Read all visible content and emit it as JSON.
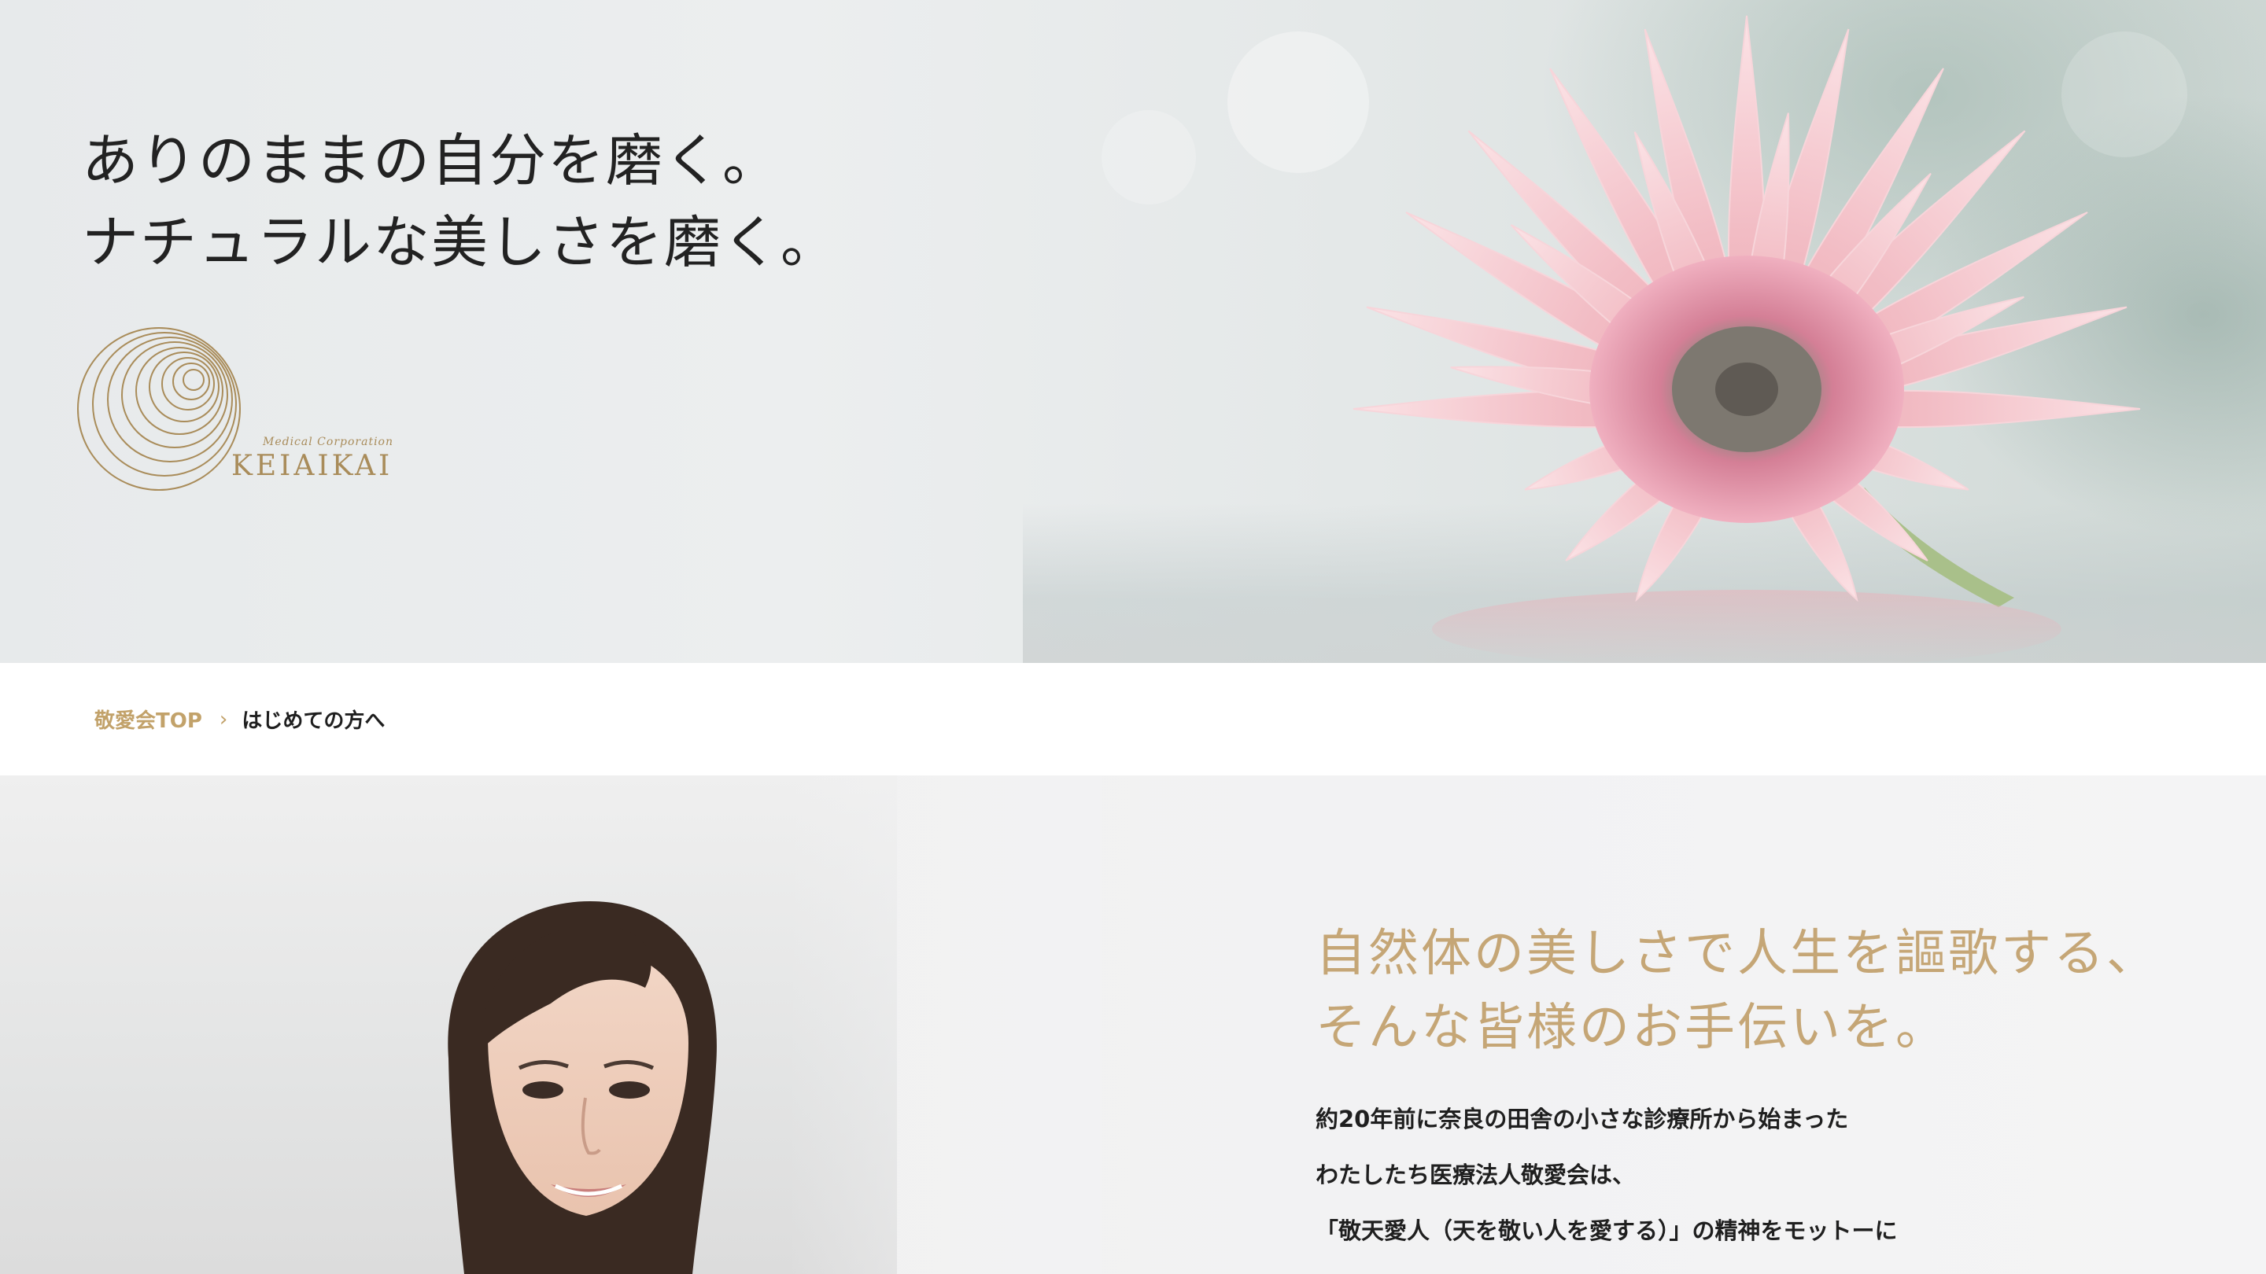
{
  "hero": {
    "title_line1": "ありのままの自分を磨く。",
    "title_line2": "ナチュラルな美しさを磨く。",
    "logo": {
      "subtitle": "Medical Corporation",
      "name": "KEIAIKAI",
      "color": "#a98c5a"
    }
  },
  "breadcrumb": {
    "home_label": "敬愛会TOP",
    "separator": "›",
    "current_label": "はじめての方へ"
  },
  "intro": {
    "heading_line1": "自然体の美しさで人生を謳歌する、",
    "heading_line2": "そんな皆様のお手伝いを。",
    "body_lines": [
      "約20年前に奈良の田舎の小さな診療所から始まった",
      "わたしたち医療法人敬愛会は、",
      "「敬天愛人（天を敬い人を愛する）」の精神をモットーに"
    ],
    "accent_color": "#c5a676"
  }
}
